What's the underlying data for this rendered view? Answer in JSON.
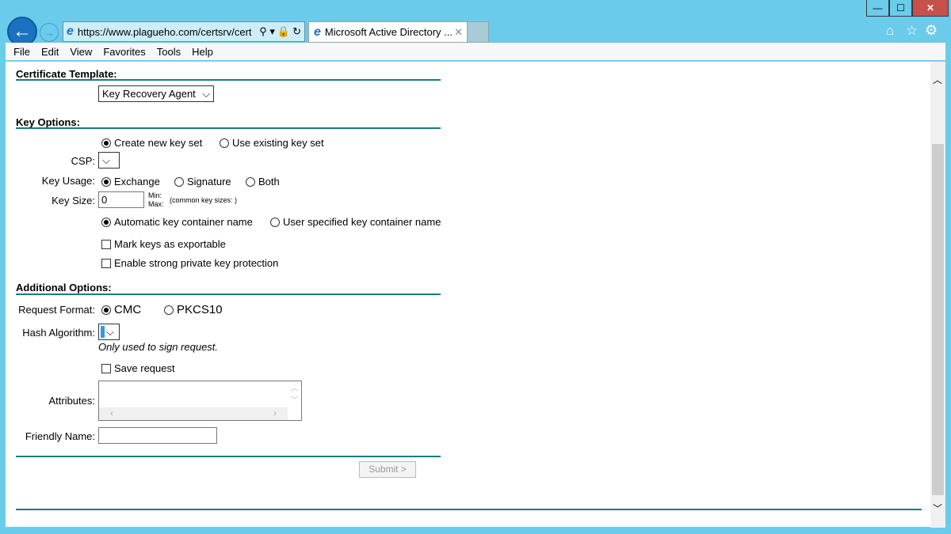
{
  "browser": {
    "url": "https://www.plagueho.com/certsrv/cert",
    "tab_title": "Microsoft Active Directory ...",
    "menu": [
      "File",
      "Edit",
      "View",
      "Favorites",
      "Tools",
      "Help"
    ],
    "window_buttons": {
      "minimize": "—",
      "maximize": "☐",
      "close": "✕"
    }
  },
  "form": {
    "cert_template_heading": "Certificate Template:",
    "cert_template_value": "Key Recovery Agent",
    "key_options_heading": "Key Options:",
    "create_new": "Create new key set",
    "use_existing": "Use existing key set",
    "csp_label": "CSP:",
    "key_usage_label": "Key Usage:",
    "exchange": "Exchange",
    "signature": "Signature",
    "both": "Both",
    "key_size_label": "Key Size:",
    "key_size_value": "0",
    "min": "Min:",
    "max": "Max:",
    "common_sizes": "(common key sizes: )",
    "auto_container": "Automatic key container name",
    "user_container": "User specified key container name",
    "exportable": "Mark keys as exportable",
    "strong_protection": "Enable strong private key protection",
    "additional_heading": "Additional Options:",
    "request_format_label": "Request Format:",
    "cmc": "CMC",
    "pkcs10": "PKCS10",
    "hash_label": "Hash Algorithm:",
    "hash_note": "Only used to sign request.",
    "save_request": "Save request",
    "attributes_label": "Attributes:",
    "friendly_label": "Friendly Name:",
    "submit": "Submit >"
  }
}
